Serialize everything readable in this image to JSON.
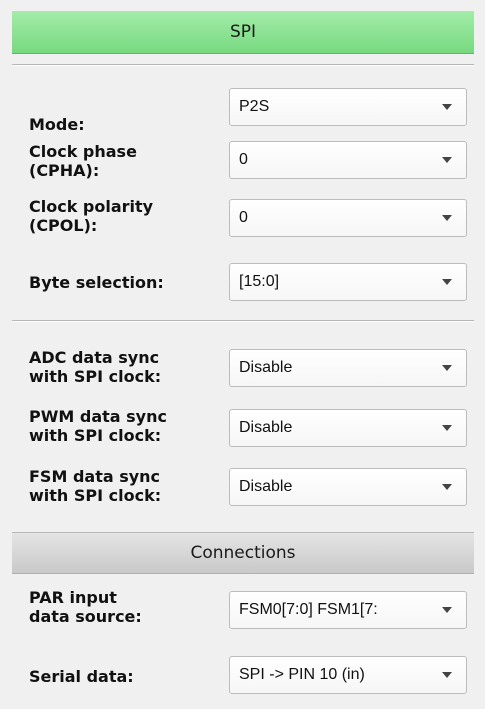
{
  "spi_section": {
    "title": "SPI",
    "fields": [
      {
        "label": "Mode:",
        "value": "P2S"
      },
      {
        "label": "Clock phase\n(CPHA):",
        "value": "0"
      },
      {
        "label": "Clock polarity\n(CPOL):",
        "value": "0"
      },
      {
        "label": "Byte selection:",
        "value": "[15:0]"
      },
      {
        "label": "ADC data sync\nwith SPI clock:",
        "value": "Disable"
      },
      {
        "label": "PWM data sync\nwith SPI clock:",
        "value": "Disable"
      },
      {
        "label": "FSM data sync\nwith SPI clock:",
        "value": "Disable"
      }
    ]
  },
  "connections_section": {
    "title": "Connections",
    "fields": [
      {
        "label": "PAR input\ndata source:",
        "value": "FSM0[7:0] FSM1[7:"
      },
      {
        "label": "Serial data:",
        "value": "SPI -> PIN 10 (in)"
      }
    ]
  },
  "icons": {
    "dropdown": "chevron-down-icon"
  },
  "colors": {
    "spi_header": "#8be293",
    "connections_header": "#d4d4d4",
    "background": "#f0f0f0"
  }
}
